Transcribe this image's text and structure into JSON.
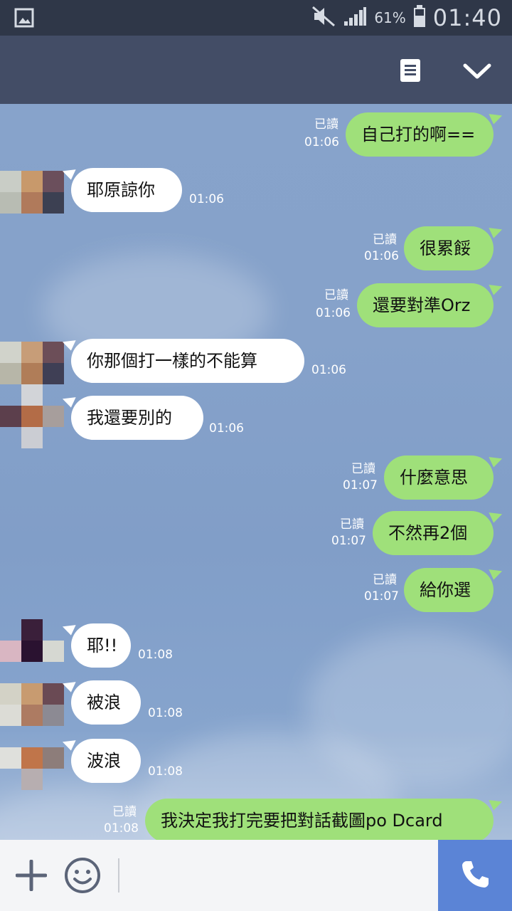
{
  "status_bar": {
    "battery_percent": "61%",
    "clock": "01:40",
    "icons": [
      "gallery-icon",
      "mute-icon",
      "signal-icon",
      "battery-icon"
    ]
  },
  "header": {
    "icons": [
      "notes-icon",
      "chevron-down-icon"
    ]
  },
  "messages": [
    {
      "dir": "out",
      "text": "自己打的啊==",
      "read": "已讀",
      "time": "01:06"
    },
    {
      "dir": "in",
      "text": "耶原諒你",
      "time": "01:06"
    },
    {
      "dir": "out",
      "text": "很累餒",
      "read": "已讀",
      "time": "01:06"
    },
    {
      "dir": "out",
      "text": "還要對準Orz",
      "read": "已讀",
      "time": "01:06"
    },
    {
      "dir": "in",
      "text": "你那個打一樣的不能算",
      "time": "01:06"
    },
    {
      "dir": "in",
      "text": "我還要別的",
      "time": "01:06"
    },
    {
      "dir": "out",
      "text": "什麼意思",
      "read": "已讀",
      "time": "01:07"
    },
    {
      "dir": "out",
      "text": "不然再2個",
      "read": "已讀",
      "time": "01:07"
    },
    {
      "dir": "out",
      "text": "給你選",
      "read": "已讀",
      "time": "01:07"
    },
    {
      "dir": "in",
      "text": "耶!!",
      "time": "01:08"
    },
    {
      "dir": "in",
      "text": "被浪",
      "time": "01:08"
    },
    {
      "dir": "in",
      "text": "波浪",
      "time": "01:08"
    },
    {
      "dir": "out",
      "text": "我決定我打完要把對話截圖po Dcard",
      "read": "已讀",
      "time": "01:08"
    }
  ],
  "input_bar": {
    "icons": [
      "plus-icon",
      "smile-icon",
      "phone-icon"
    ]
  },
  "colors": {
    "status_bar": "#2f3748",
    "header": "#434d66",
    "outgoing_bubble": "#9fe07a",
    "incoming_bubble": "#ffffff",
    "call_button": "#5b84d6"
  }
}
